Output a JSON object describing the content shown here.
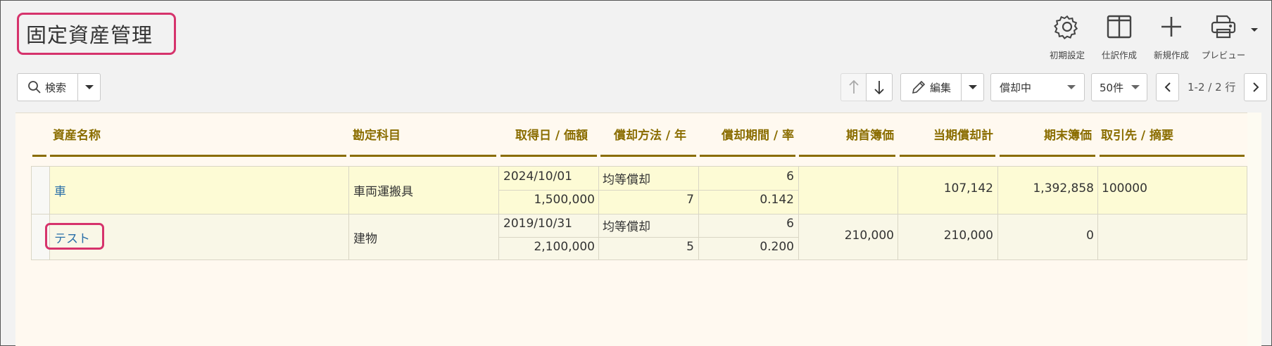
{
  "page": {
    "title": "固定資産管理"
  },
  "tools": [
    {
      "icon": "gear-icon",
      "label": "初期設定"
    },
    {
      "icon": "columns-icon",
      "label": "仕訳作成"
    },
    {
      "icon": "plus-icon",
      "label": "新規作成"
    },
    {
      "icon": "printer-icon",
      "label": "プレビュー"
    }
  ],
  "toolbar": {
    "search_label": "検索",
    "edit_label": "編集",
    "status_select": "償却中",
    "per_page_select": "50件",
    "pager_text": "1-2 / 2 行"
  },
  "table": {
    "headers": {
      "name": "資産名称",
      "account": "勘定科目",
      "acquired": "取得日 / 価額",
      "method": "償却方法 / 年",
      "period": "償却期間 / 率",
      "opening": "期首簿価",
      "current": "当期償却計",
      "closing": "期末簿価",
      "partner": "取引先 / 摘要"
    },
    "rows": [
      {
        "name": "車",
        "account": "車両運搬具",
        "date": "2024/10/01",
        "price": "1,500,000",
        "method": "均等償却",
        "years": "7",
        "period": "6",
        "rate": "0.142",
        "opening": "",
        "current": "107,142",
        "closing": "1,392,858",
        "partner": "100000"
      },
      {
        "name": "テスト",
        "account": "建物",
        "date": "2019/10/31",
        "price": "2,100,000",
        "method": "均等償却",
        "years": "5",
        "period": "6",
        "rate": "0.200",
        "opening": "210,000",
        "current": "210,000",
        "closing": "0",
        "partner": ""
      }
    ]
  },
  "colors": {
    "header_text": "#8a6d00",
    "highlight": "#d6336c",
    "link": "#2a6fa8"
  }
}
